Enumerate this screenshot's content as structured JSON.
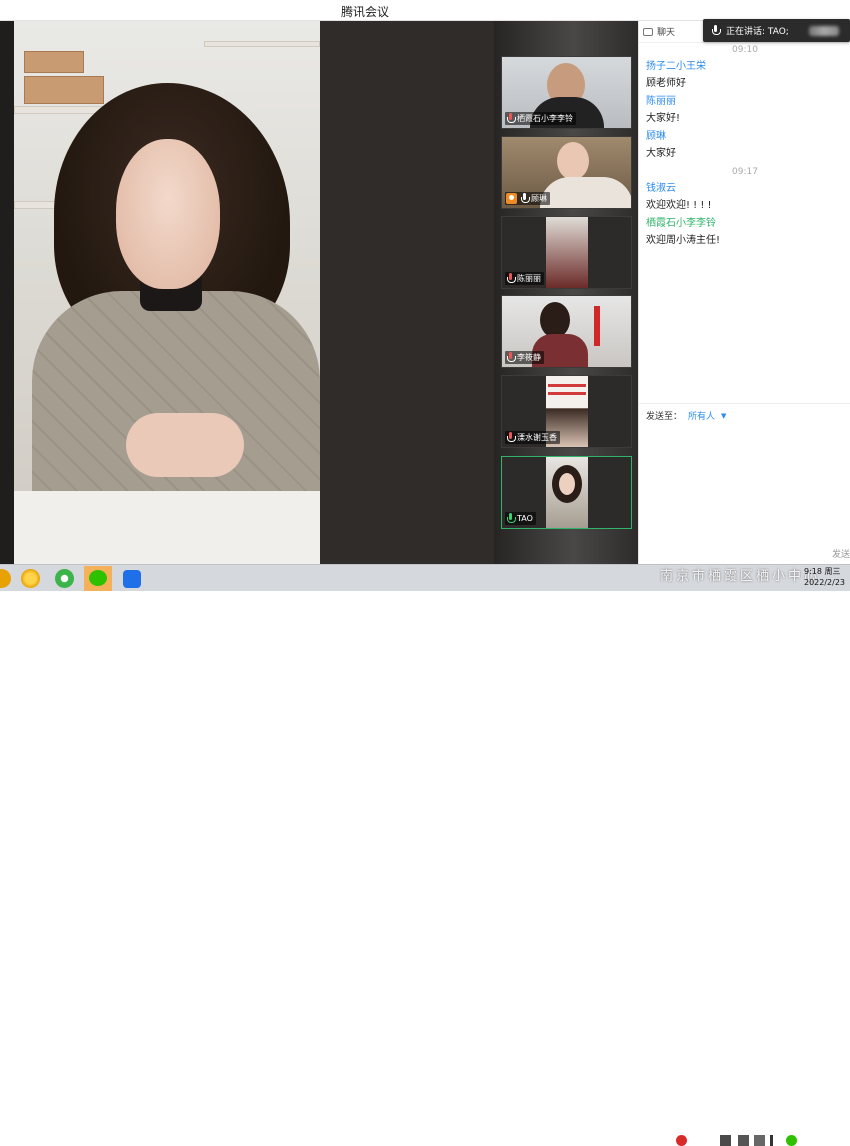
{
  "window": {
    "title": "腾讯会议"
  },
  "speaking_banner": {
    "text": "正在讲话: TAO;"
  },
  "participants": [
    {
      "name": "栖霞石小李李铃",
      "mic": "muted"
    },
    {
      "name": "顾琳",
      "mic": "on",
      "host": true
    },
    {
      "name": "陈丽丽",
      "mic": "muted"
    },
    {
      "name": "李筱静",
      "mic": "muted"
    },
    {
      "name": "溧水谢玉香",
      "mic": "muted"
    },
    {
      "name": "TAO",
      "mic": "speaking",
      "active": true
    }
  ],
  "chat": {
    "header": "聊天",
    "messages": [
      {
        "time": "09:10"
      },
      {
        "sender": "扬子二小王栄",
        "text": "顾老师好"
      },
      {
        "sender": "陈丽丽",
        "text": "大家好!"
      },
      {
        "sender": "顾琳",
        "text": "大家好"
      },
      {
        "time": "09:17"
      },
      {
        "sender": "钱淑云",
        "text": "欢迎欢迎! ! ! !"
      },
      {
        "sender": "栖霞石小李李铃",
        "text": "欢迎周小涛主任!",
        "self": true
      }
    ],
    "send_to_label": "发送至：",
    "send_to_value": "所有人",
    "send_button": "发送"
  },
  "taskbar": {
    "watermark": "南京市栖霞区栖小中心",
    "clock_line1": "9:18 周三",
    "clock_line2": "2022/2/23"
  },
  "colors": {
    "sender_blue": "#2d8cf0",
    "sender_green": "#2fb46a",
    "active_border": "#2fb46a"
  }
}
